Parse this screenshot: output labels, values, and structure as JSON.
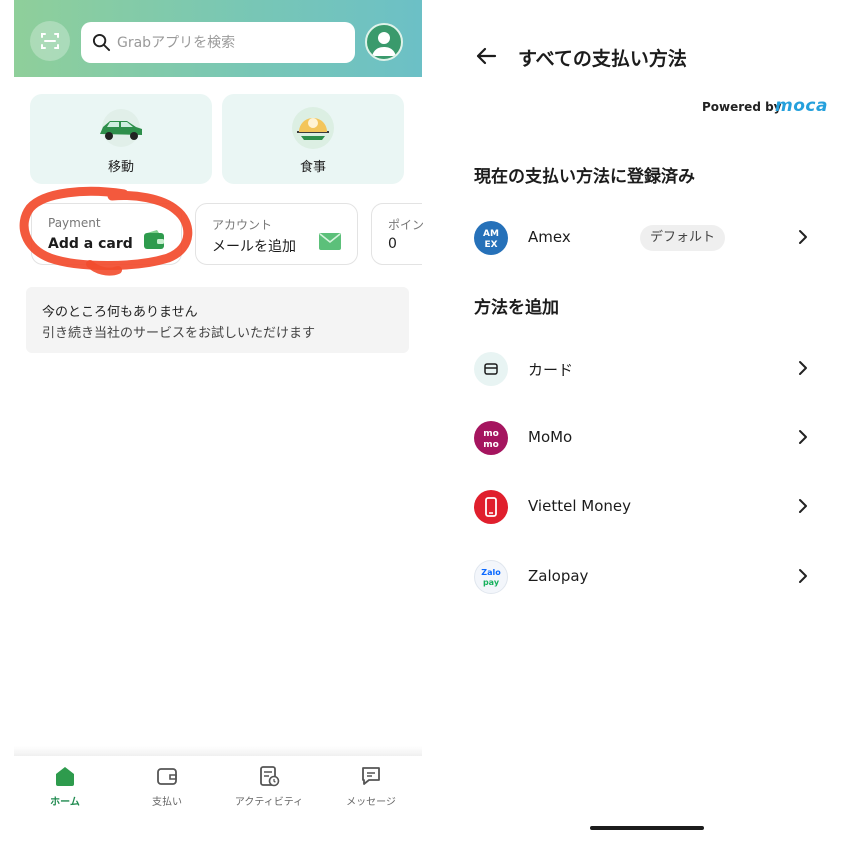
{
  "left": {
    "header": {
      "search_placeholder": "Grabアプリを検索"
    },
    "services": [
      {
        "label": "移動",
        "icon": "car-icon"
      },
      {
        "label": "食事",
        "icon": "food-icon"
      }
    ],
    "payment_pills": [
      {
        "title": "Payment",
        "value": "Add a card",
        "icon": "wallet-icon"
      },
      {
        "title": "アカウント",
        "value": "メールを追加",
        "icon": "mail-icon"
      },
      {
        "title": "ポイン",
        "value": "0"
      }
    ],
    "empty_state": {
      "line1": "今のところ何もありません",
      "line2": "引き続き当社のサービスをお試しいただけます"
    },
    "bottom_nav": [
      {
        "label": "ホーム",
        "icon": "home-icon",
        "active": true
      },
      {
        "label": "支払い",
        "icon": "wallet-icon"
      },
      {
        "label": "アクティビティ",
        "icon": "activity-icon"
      },
      {
        "label": "メッセージ",
        "icon": "chat-icon"
      }
    ],
    "colors": {
      "accent": "#1f8a4f",
      "highlight_scribble": "#f24b2c"
    }
  },
  "right": {
    "title": "すべての支払い方法",
    "powered_by": "Powered by",
    "brand": "moca",
    "current_section": {
      "title": "現在の支払い方法に登録済み",
      "items": [
        {
          "label": "Amex",
          "badge": "デフォルト",
          "icon": "amex-icon"
        }
      ]
    },
    "add_section": {
      "title": "方法を追加",
      "items": [
        {
          "label": "カード",
          "icon": "card-icon"
        },
        {
          "label": "MoMo",
          "icon": "momo-icon"
        },
        {
          "label": "Viettel Money",
          "icon": "viettel-icon"
        },
        {
          "label": "Zalopay",
          "icon": "zalopay-icon"
        }
      ]
    },
    "colors": {
      "brand": "#25a0dc"
    }
  }
}
